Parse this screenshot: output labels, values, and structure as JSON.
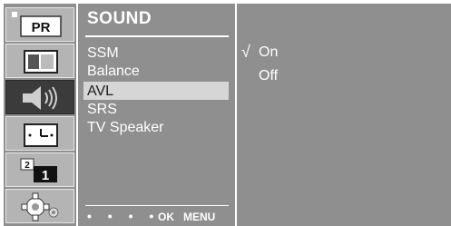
{
  "sidebar": {
    "icons": [
      {
        "name": "picture-pr-icon",
        "label": "PR"
      },
      {
        "name": "screen-icon"
      },
      {
        "name": "sound-icon",
        "active": true
      },
      {
        "name": "time-icon"
      },
      {
        "name": "special-icon",
        "label_small": "2",
        "label_big": "1"
      },
      {
        "name": "setup-gear-icon"
      }
    ]
  },
  "menu": {
    "title": "SOUND",
    "items": [
      {
        "label": "SSM"
      },
      {
        "label": "Balance"
      },
      {
        "label": "AVL",
        "selected": true
      },
      {
        "label": "SRS"
      },
      {
        "label": "TV Speaker"
      }
    ],
    "footer": {
      "dots": "• • • •",
      "ok": "OK",
      "menu": "MENU"
    }
  },
  "options": {
    "check_mark": "√",
    "items": [
      {
        "label": "On",
        "checked": true
      },
      {
        "label": "Off"
      }
    ]
  },
  "colors": {
    "panel": "#8f8f8f",
    "highlight": "#d6d6d6",
    "text": "#ffffff",
    "selected_text": "#1c1c1c"
  }
}
